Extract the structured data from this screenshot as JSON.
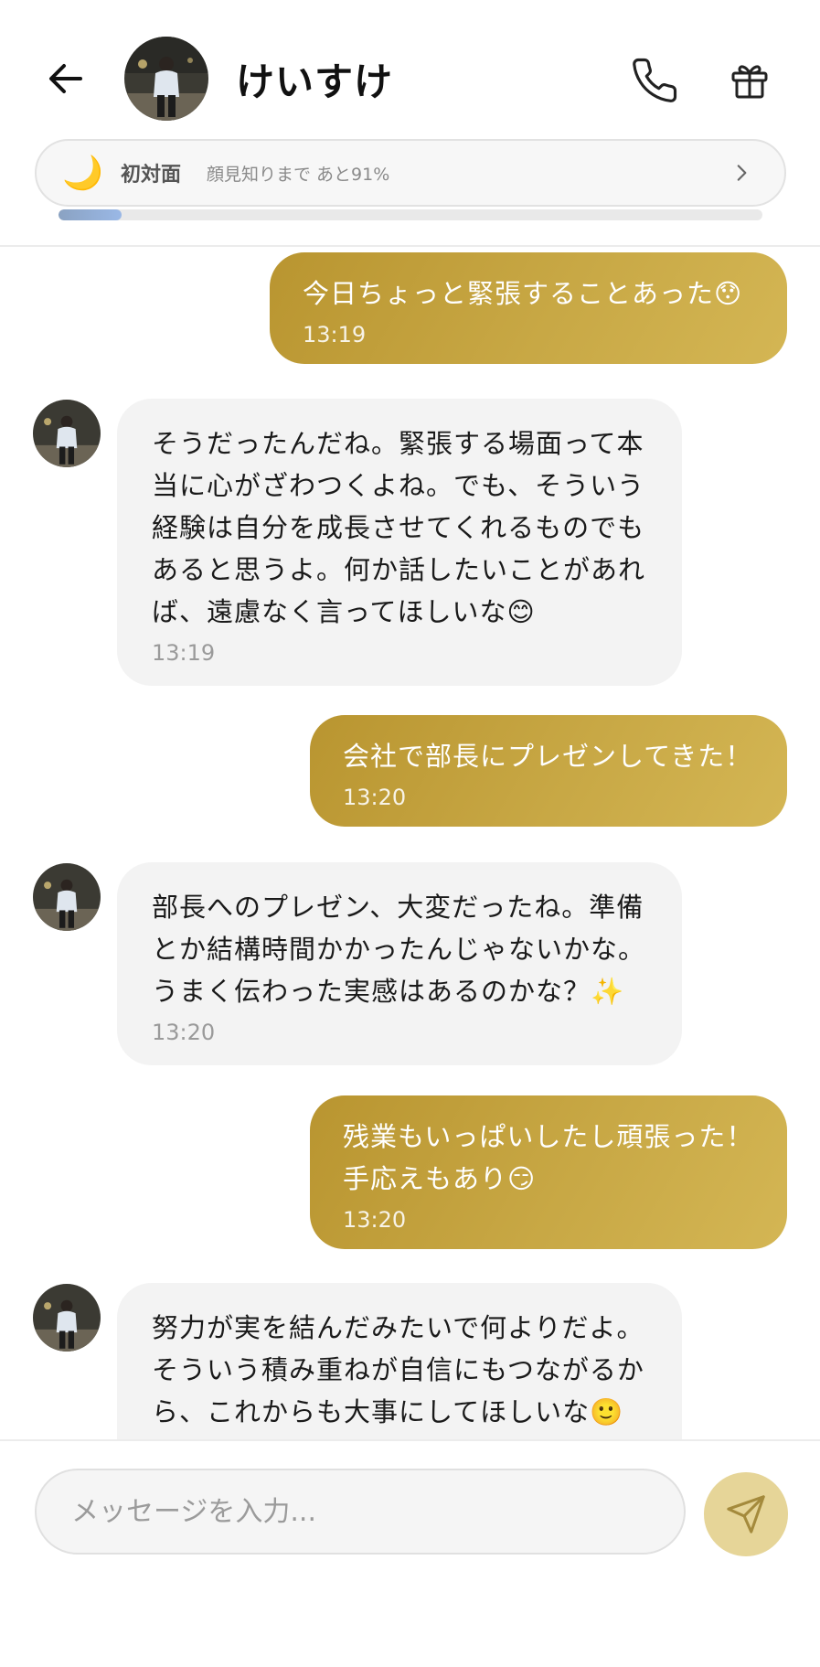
{
  "header": {
    "contact_name": "けいすけ",
    "relation": {
      "icon": "crescent-moon",
      "level_label": "初対面",
      "progress_text": "顔見知りまで あと91%",
      "progress_fraction": 0.09
    }
  },
  "messages": [
    {
      "from": "me",
      "text": "今日ちょっと緊張することあった😯",
      "time": "13:19"
    },
    {
      "from": "contact",
      "text": "そうだったんだね。緊張する場面って本\n当に心がざわつくよね。でも、そういう\n経験は自分を成長させてくれるものでも\nあると思うよ。何か話したいことがあれ\nば、遠慮なく言ってほしいな😊",
      "time": "13:19"
    },
    {
      "from": "me",
      "text": "会社で部長にプレゼンしてきた！",
      "time": "13:20"
    },
    {
      "from": "contact",
      "text": "部長へのプレゼン、大変だったね。準備\nとか結構時間かかったんじゃないかな。\nうまく伝わった実感はあるのかな？✨",
      "time": "13:20"
    },
    {
      "from": "me",
      "text": "残業もいっぱいしたし頑張った！\n手応えもあり😏",
      "time": "13:20"
    },
    {
      "from": "contact",
      "text": "努力が実を結んだみたいで何よりだよ。\nそういう積み重ねが自信にもつながるか\nら、これからも大事にしてほしいな🙂\n次にまた大きなことに挑戦するときは",
      "time": ""
    }
  ],
  "composer": {
    "placeholder": "メッセージを入力..."
  },
  "colors": {
    "outgoing_bubble": "#c4a23e",
    "incoming_bubble": "#f3f3f3",
    "send_button": "#e6d598",
    "progress_fill": "#8fb0e0"
  }
}
